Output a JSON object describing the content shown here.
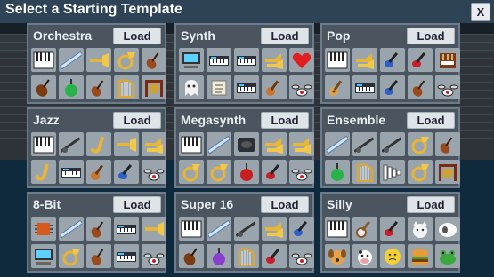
{
  "dialog": {
    "title": "Select a Starting Template",
    "close_label": "X"
  },
  "colors": {
    "accent": "#2e4356",
    "card": "#4a5560",
    "tile": "#9aa4ad"
  },
  "templates": [
    {
      "name": "Orchestra",
      "load_label": "Load",
      "icons": [
        "piano-icon",
        "flute-icon",
        "trumpet-icon",
        "tuba-icon",
        "violin-icon",
        "cello-icon",
        "green-button-icon",
        "violin-icon",
        "harp-icon",
        "gong-icon"
      ]
    },
    {
      "name": "Synth",
      "load_label": "Load",
      "icons": [
        "computer-icon",
        "keyboard-icon",
        "keyboard-icon",
        "horn-section-icon",
        "heart-icon",
        "ghost-icon",
        "scroll-icon",
        "keyboard-icon",
        "guitar-icon",
        "drums-icon"
      ]
    },
    {
      "name": "Pop",
      "load_label": "Load",
      "icons": [
        "piano-icon",
        "horn-section-icon",
        "bass-guitar-icon",
        "electric-guitar-icon",
        "organ-icon",
        "acoustic-guitar-icon",
        "keyboard-icon",
        "bass-guitar-icon",
        "violin-icon",
        "drums-icon"
      ]
    },
    {
      "name": "Jazz",
      "load_label": "Load",
      "icons": [
        "piano-icon",
        "clarinet-icon",
        "saxophone-icon",
        "trumpet-icon",
        "horn-section-icon",
        "saxophone-icon",
        "keyboard-icon",
        "guitar-icon",
        "bass-guitar-icon",
        "drums-icon"
      ]
    },
    {
      "name": "Megasynth",
      "load_label": "Load",
      "icons": [
        "piano-icon",
        "flute-icon",
        "speaker-icon",
        "horn-section-icon",
        "horn-section-icon",
        "tuba-icon",
        "tuba-icon",
        "red-button-icon",
        "electric-guitar-icon",
        "drums-icon"
      ]
    },
    {
      "name": "Ensemble",
      "load_label": "Load",
      "icons": [
        "flute-icon",
        "clarinet-icon",
        "clarinet-icon",
        "tuba-icon",
        "violin-icon",
        "green-button-icon",
        "harp-icon",
        "xylophone-icon",
        "tuba-icon",
        "gong-icon"
      ]
    },
    {
      "name": "8-Bit",
      "load_label": "Load",
      "icons": [
        "chip-icon",
        "flute-icon",
        "violin-icon",
        "keyboard-icon",
        "trumpet-icon",
        "computer-icon",
        "tuba-icon",
        "violin-icon",
        "keyboard-icon",
        "drums-icon"
      ]
    },
    {
      "name": "Super 16",
      "load_label": "Load",
      "icons": [
        "piano-icon",
        "flute-icon",
        "clarinet-icon",
        "horn-section-icon",
        "bass-guitar-icon",
        "cello-icon",
        "purple-button-icon",
        "harp-icon",
        "electric-guitar-icon",
        "drums-icon"
      ]
    },
    {
      "name": "Silly",
      "load_label": "Load",
      "icons": [
        "piano-icon",
        "banjo-icon",
        "electric-guitar-icon",
        "cat-icon",
        "sheep-icon",
        "dog-icon",
        "cow-icon",
        "emoji-face-icon",
        "burger-icon",
        "frog-icon"
      ]
    }
  ]
}
